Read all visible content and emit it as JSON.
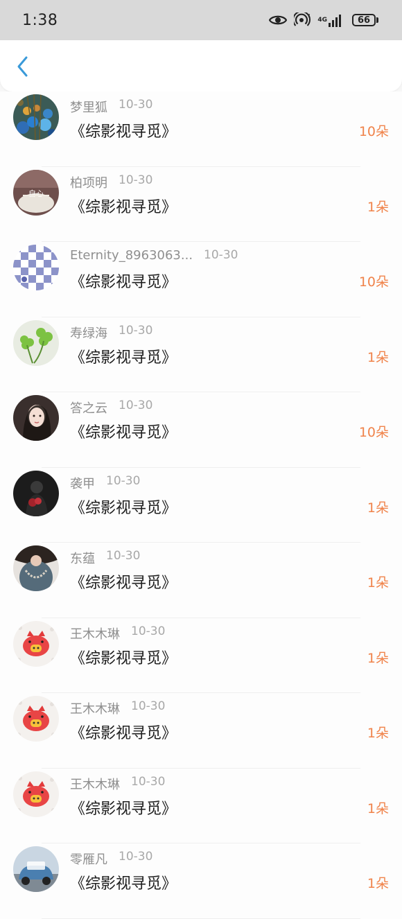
{
  "status_bar": {
    "time": "1:38",
    "network": "4G",
    "battery": "66"
  },
  "header": {
    "back_icon": "chevron-left-icon",
    "accent": "#3a9ad9"
  },
  "colors": {
    "amount": "#f0834a",
    "name": "#8f8f8f",
    "title": "#1f1f1f"
  },
  "rows": [
    {
      "name": "梦里狐",
      "date": "10-30",
      "title": "《综影视寻觅》",
      "amount": "10朵",
      "avatar": "flowers-avatar"
    },
    {
      "name": "柏项明",
      "date": "10-30",
      "title": "《综影视寻觅》",
      "amount": "1朵",
      "avatar": "text-sign-avatar"
    },
    {
      "name": "Eternity_8963063...",
      "date": "10-30",
      "title": "《综影视寻觅》",
      "amount": "10朵",
      "avatar": "checker-avatar"
    },
    {
      "name": "寿绿海",
      "date": "10-30",
      "title": "《综影视寻觅》",
      "amount": "1朵",
      "avatar": "clover-avatar"
    },
    {
      "name": "答之云",
      "date": "10-30",
      "title": "《综影视寻觅》",
      "amount": "10朵",
      "avatar": "portrait-avatar"
    },
    {
      "name": "袭甲",
      "date": "10-30",
      "title": "《综影视寻觅》",
      "amount": "1朵",
      "avatar": "dark-avatar"
    },
    {
      "name": "东蕴",
      "date": "10-30",
      "title": "《综影视寻觅》",
      "amount": "1朵",
      "avatar": "necklace-avatar"
    },
    {
      "name": "王木木琳",
      "date": "10-30",
      "title": "《综影视寻觅》",
      "amount": "1朵",
      "avatar": "pig-avatar"
    },
    {
      "name": "王木木琳",
      "date": "10-30",
      "title": "《综影视寻觅》",
      "amount": "1朵",
      "avatar": "pig-avatar"
    },
    {
      "name": "王木木琳",
      "date": "10-30",
      "title": "《综影视寻觅》",
      "amount": "1朵",
      "avatar": "pig-avatar"
    },
    {
      "name": "零雁凡",
      "date": "10-30",
      "title": "《综影视寻觅》",
      "amount": "1朵",
      "avatar": "car-avatar"
    }
  ]
}
